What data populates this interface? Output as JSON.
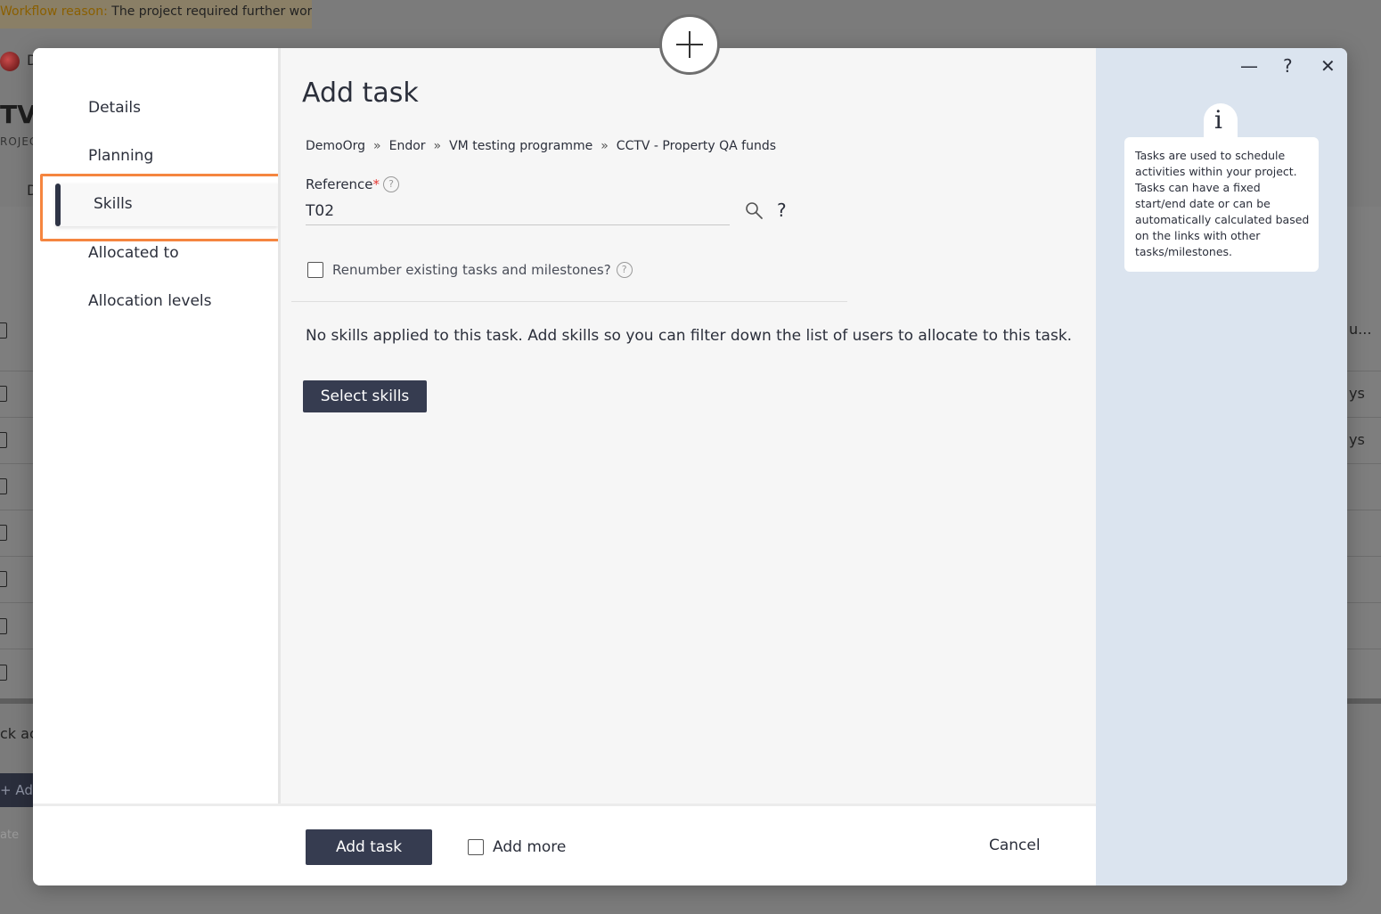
{
  "background": {
    "workflow_label": "Workflow reason:",
    "workflow_text": "The project required further work.",
    "header_letter": "D",
    "project_title": "TV",
    "project_sub": "ROJEC",
    "tab_letter": "D",
    "row_text_1": "u...",
    "row_text_2": "ys",
    "row_text_3": "ys",
    "quick_add": "ck ac",
    "add_label": "+ Add",
    "date_label": "ate"
  },
  "sidebar": {
    "items": [
      {
        "label": "Details"
      },
      {
        "label": "Planning"
      },
      {
        "label": "Skills"
      },
      {
        "label": "Allocated to"
      },
      {
        "label": "Allocation levels"
      }
    ],
    "active_index": 2
  },
  "main": {
    "title": "Add task",
    "breadcrumbs": [
      "DemoOrg",
      "Endor",
      "VM testing programme",
      "CCTV - Property QA funds"
    ],
    "breadcrumb_separator": "»",
    "reference_label": "Reference",
    "required_marker": "*",
    "reference_value": "T02",
    "help_symbol": "?",
    "renumber_label": "Renumber existing tasks and milestones?",
    "renumber_checked": false,
    "no_skills_text": "No skills applied to this task. Add skills so you can filter down the list of users to allocate to this task.",
    "select_skills_label": "Select skills"
  },
  "footer": {
    "add_task_label": "Add task",
    "add_more_label": "Add more",
    "add_more_checked": false,
    "cancel_label": "Cancel"
  },
  "info_panel": {
    "minimize_symbol": "—",
    "help_symbol": "?",
    "close_symbol": "✕",
    "info_symbol": "i",
    "text": "Tasks are used to schedule activities within your project. Tasks can have a fixed start/end date or can be automatically calculated based on the links with other tasks/milestones."
  },
  "colors": {
    "accent_dark": "#363c50",
    "highlight": "#f58540",
    "info_bg": "#dbe4ef",
    "required": "#e53935"
  }
}
